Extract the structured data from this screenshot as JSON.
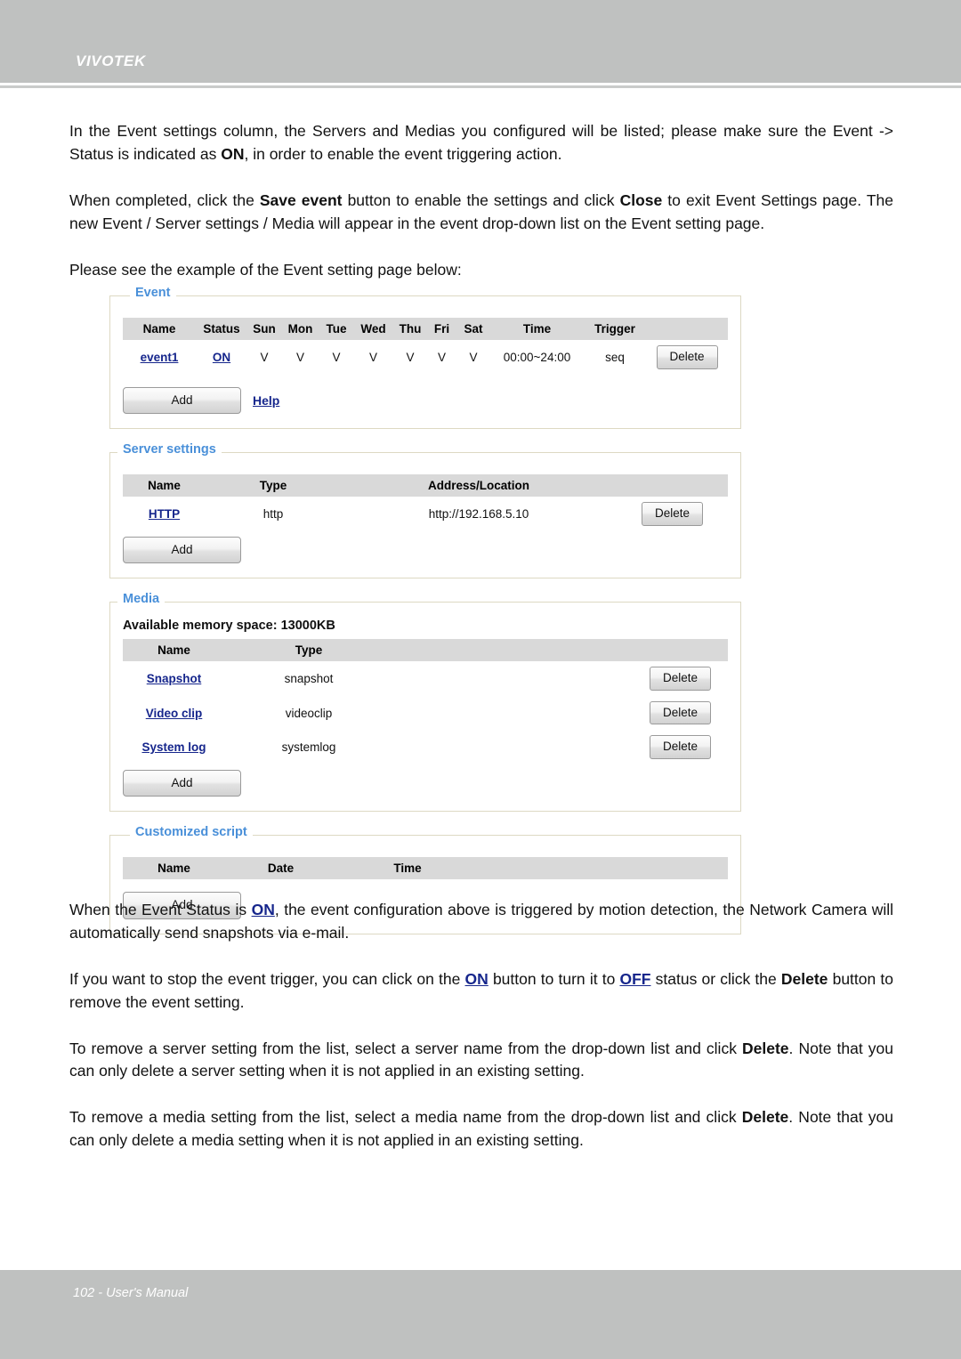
{
  "header": {
    "brand": "VIVOTEK"
  },
  "footer": {
    "text": "102 - User's Manual"
  },
  "intro": {
    "p1_a": "In the Event settings column, the Servers and Medias you configured will be listed; please make sure the Event -> Status is indicated as ",
    "p1_on": "ON",
    "p1_b": ", in order to enable the event triggering action.",
    "p2_a": "When completed, click the ",
    "p2_save": "Save event",
    "p2_b": " button to enable the settings and click ",
    "p2_close": "Close",
    "p2_c": " to exit Event Settings page. The new Event / Server settings / Media will appear in the event drop-down list on the Event setting page.",
    "p3": "Please see the example of the Event setting page below:"
  },
  "outro": {
    "p4_a": "When the Event Status is ",
    "p4_on": "ON",
    "p4_b": ", the event configuration above is triggered by motion detection, the Network Camera will  automatically send snapshots via e-mail.",
    "p5_a": "If you want to stop the event trigger, you can click on the ",
    "p5_on": "ON",
    "p5_b": " button to turn it to ",
    "p5_off": "OFF",
    "p5_c": " status or click the ",
    "p5_delete": "Delete",
    "p5_d": " button to remove the event setting.",
    "p6_a": "To remove a server setting from the list, select a server name from the drop-down list and click ",
    "p6_delete": "Delete",
    "p6_b": ". Note that you can only delete a server setting when it is not applied in an existing setting.",
    "p7_a": "To remove a media setting from the list, select a media name from the drop-down list and click ",
    "p7_delete": "Delete",
    "p7_b": ". Note that you can only delete a media setting when it is not applied in an existing setting."
  },
  "ui": {
    "event_panel": {
      "legend": "Event",
      "columns": [
        "Name",
        "Status",
        "Sun",
        "Mon",
        "Tue",
        "Wed",
        "Thu",
        "Fri",
        "Sat",
        "Time",
        "Trigger"
      ],
      "row": {
        "name": "event1",
        "status": "ON",
        "sun": "V",
        "mon": "V",
        "tue": "V",
        "wed": "V",
        "thu": "V",
        "fri": "V",
        "sat": "V",
        "time": "00:00~24:00",
        "trigger": "seq",
        "delete_label": "Delete"
      },
      "add_label": "Add",
      "help_label": "Help"
    },
    "server_panel": {
      "legend": "Server settings",
      "columns": [
        "Name",
        "Type",
        "Address/Location"
      ],
      "row": {
        "name": "HTTP",
        "type": "http",
        "address": "http://192.168.5.10",
        "delete_label": "Delete"
      },
      "add_label": "Add"
    },
    "media_panel": {
      "legend": "Media",
      "memory_line": "Available memory space: 13000KB",
      "columns": [
        "Name",
        "Type"
      ],
      "rows": [
        {
          "name": "Snapshot",
          "type": "snapshot",
          "delete_label": "Delete"
        },
        {
          "name": "Video clip",
          "type": "videoclip",
          "delete_label": "Delete"
        },
        {
          "name": "System log",
          "type": "systemlog",
          "delete_label": "Delete"
        }
      ],
      "add_label": "Add"
    },
    "script_panel": {
      "legend": "Customized script",
      "columns": [
        "Name",
        "Date",
        "Time"
      ],
      "add_label": "Add"
    }
  },
  "colors": {
    "chrome_gray": "#bfc1c0",
    "legend_blue": "#4a90d9",
    "link_blue": "#16268c",
    "panel_border": "#ddd9c3",
    "table_header": "#d9d9d9"
  }
}
